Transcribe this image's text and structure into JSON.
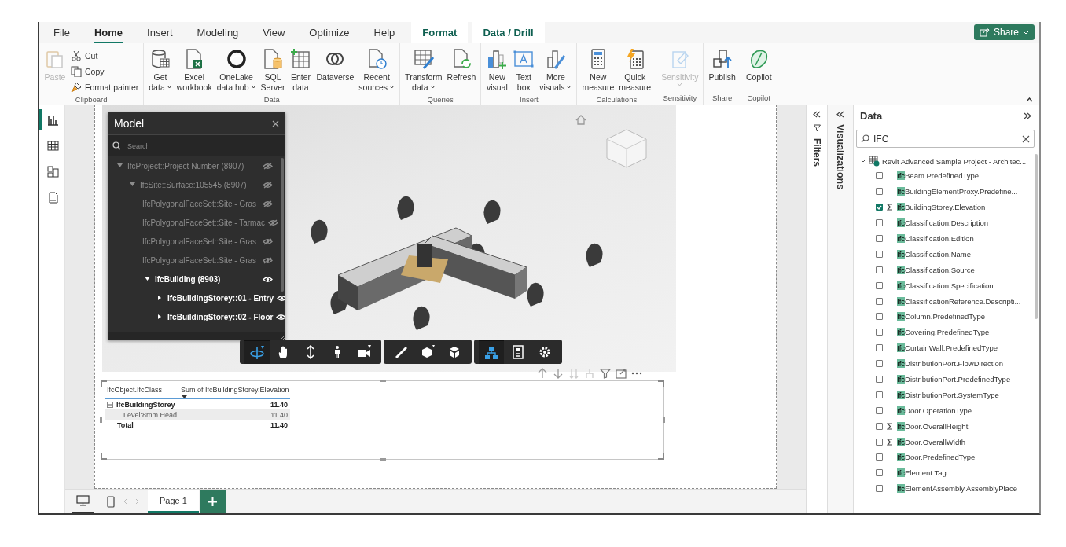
{
  "menu_tabs": [
    {
      "label": "File",
      "selected": false,
      "kind": "standard"
    },
    {
      "label": "Home",
      "selected": true,
      "kind": "standard"
    },
    {
      "label": "Insert",
      "selected": false,
      "kind": "standard"
    },
    {
      "label": "Modeling",
      "selected": false,
      "kind": "standard"
    },
    {
      "label": "View",
      "selected": false,
      "kind": "standard"
    },
    {
      "label": "Optimize",
      "selected": false,
      "kind": "standard"
    },
    {
      "label": "Help",
      "selected": false,
      "kind": "standard"
    },
    {
      "label": "Format",
      "selected": false,
      "kind": "contextual"
    },
    {
      "label": "Data / Drill",
      "selected": false,
      "kind": "contextual"
    }
  ],
  "share_button": {
    "label": "Share"
  },
  "ribbon_groups": [
    {
      "label": "Clipboard",
      "items": [
        {
          "kind": "large",
          "lines": [
            "Paste"
          ],
          "dropdown": false,
          "disabled": true
        },
        {
          "kind": "small",
          "lines": [
            "Cut"
          ],
          "disabled": false
        },
        {
          "kind": "small",
          "lines": [
            "Copy"
          ],
          "disabled": false
        },
        {
          "kind": "small",
          "lines": [
            "Format painter"
          ],
          "disabled": false
        }
      ]
    },
    {
      "label": "Data",
      "items": [
        {
          "kind": "large",
          "lines": [
            "Get",
            "data"
          ],
          "dropdown": true,
          "disabled": false
        },
        {
          "kind": "large",
          "lines": [
            "Excel",
            "workbook"
          ],
          "dropdown": false,
          "disabled": false
        },
        {
          "kind": "large",
          "lines": [
            "OneLake",
            "data hub"
          ],
          "dropdown": true,
          "disabled": false
        },
        {
          "kind": "large",
          "lines": [
            "SQL",
            "Server"
          ],
          "dropdown": false,
          "disabled": false
        },
        {
          "kind": "large",
          "lines": [
            "Enter",
            "data"
          ],
          "dropdown": false,
          "disabled": false
        },
        {
          "kind": "large",
          "lines": [
            "Dataverse"
          ],
          "dropdown": false,
          "disabled": false
        },
        {
          "kind": "large",
          "lines": [
            "Recent",
            "sources"
          ],
          "dropdown": true,
          "disabled": false
        }
      ]
    },
    {
      "label": "Queries",
      "items": [
        {
          "kind": "large",
          "lines": [
            "Transform",
            "data"
          ],
          "dropdown": true,
          "disabled": false
        },
        {
          "kind": "large",
          "lines": [
            "Refresh"
          ],
          "dropdown": false,
          "disabled": false
        }
      ]
    },
    {
      "label": "Insert",
      "items": [
        {
          "kind": "large",
          "lines": [
            "New",
            "visual"
          ],
          "dropdown": false,
          "disabled": false
        },
        {
          "kind": "large",
          "lines": [
            "Text",
            "box"
          ],
          "dropdown": false,
          "disabled": false
        },
        {
          "kind": "large",
          "lines": [
            "More",
            "visuals"
          ],
          "dropdown": true,
          "disabled": false
        }
      ]
    },
    {
      "label": "Calculations",
      "items": [
        {
          "kind": "large",
          "lines": [
            "New",
            "measure"
          ],
          "dropdown": false,
          "disabled": false
        },
        {
          "kind": "large",
          "lines": [
            "Quick",
            "measure"
          ],
          "dropdown": false,
          "disabled": false
        }
      ]
    },
    {
      "label": "Sensitivity",
      "items": [
        {
          "kind": "large",
          "lines": [
            "Sensitivity"
          ],
          "dropdown": true,
          "disabled": true
        }
      ]
    },
    {
      "label": "Share",
      "items": [
        {
          "kind": "large",
          "lines": [
            "Publish"
          ],
          "dropdown": false,
          "disabled": false
        }
      ]
    },
    {
      "label": "Copilot",
      "items": [
        {
          "kind": "large",
          "lines": [
            "Copilot"
          ],
          "dropdown": false,
          "disabled": false
        }
      ]
    }
  ],
  "left_nav": [
    {
      "selected": true
    },
    {
      "selected": false
    },
    {
      "selected": false
    },
    {
      "selected": false
    }
  ],
  "model_panel": {
    "title": "Model",
    "search": {
      "placeholder": "Search"
    },
    "tree": [
      {
        "label": "IfcProject::Project Number (8907)",
        "visible": false,
        "expanded": true,
        "children": [
          {
            "label": "IfcSite::Surface:105545 (8907)",
            "visible": false,
            "expanded": true,
            "children": [
              {
                "label": "IfcPolygonalFaceSet::Site - Gras",
                "visible": false
              },
              {
                "label": "IfcPolygonalFaceSet::Site - Tarmac",
                "visible": false
              },
              {
                "label": "IfcPolygonalFaceSet::Site - Gras",
                "visible": false
              },
              {
                "label": "IfcPolygonalFaceSet::Site - Gras",
                "visible": false
              },
              {
                "label": "IfcBuilding (8903)",
                "visible": true,
                "expanded": true,
                "children": [
                  {
                    "label": "IfcBuildingStorey::01 - Entry",
                    "visible": true,
                    "expanded": false
                  },
                  {
                    "label": "IfcBuildingStorey::02 - Floor",
                    "visible": true,
                    "expanded": false
                  }
                ]
              }
            ]
          }
        ]
      }
    ]
  },
  "viewer_toolbar": [
    [
      {
        "selected": true
      },
      {
        "selected": false
      },
      {
        "selected": false
      },
      {
        "selected": false
      },
      {
        "selected": false
      }
    ],
    [
      {
        "selected": false
      },
      {
        "selected": false
      },
      {
        "selected": false
      }
    ],
    [
      {
        "selected": true
      },
      {
        "selected": false
      },
      {
        "selected": false
      }
    ]
  ],
  "table": {
    "columns": [
      {
        "label": "IfcObject.IfcClass",
        "sorted": false
      },
      {
        "label": "Sum of IfcBuildingStorey.Elevation",
        "sorted": true
      }
    ],
    "rows": [
      {
        "kind": "group",
        "expanded": true,
        "cells": [
          "IfcBuildingStorey",
          "11.40"
        ]
      },
      {
        "kind": "detail",
        "cells": [
          "Level:8mm Head",
          "11.40"
        ]
      },
      {
        "kind": "total",
        "cells": [
          "Total",
          "11.40"
        ]
      }
    ]
  },
  "filters_pane": {
    "title": "Filters"
  },
  "visualizations_pane": {
    "title": "Visualizations"
  },
  "data_pane": {
    "title": "Data",
    "search": {
      "value": "IFC"
    },
    "model": {
      "label": "Revit Advanced Sample Project - Architec...",
      "expanded": true,
      "fields": [
        {
          "label": "IfcBeam.PredefinedType",
          "kind": "text",
          "checked": false
        },
        {
          "label": "IfcBuildingElementProxy.Predefine...",
          "kind": "text",
          "checked": false
        },
        {
          "label": "IfcBuildingStorey.Elevation",
          "kind": "numeric",
          "checked": true
        },
        {
          "label": "IfcClassification.Description",
          "kind": "text",
          "checked": false
        },
        {
          "label": "IfcClassification.Edition",
          "kind": "text",
          "checked": false
        },
        {
          "label": "IfcClassification.Name",
          "kind": "text",
          "checked": false
        },
        {
          "label": "IfcClassification.Source",
          "kind": "text",
          "checked": false
        },
        {
          "label": "IfcClassification.Specification",
          "kind": "text",
          "checked": false
        },
        {
          "label": "IfcClassificationReference.Descripti...",
          "kind": "text",
          "checked": false
        },
        {
          "label": "IfcColumn.PredefinedType",
          "kind": "text",
          "checked": false
        },
        {
          "label": "IfcCovering.PredefinedType",
          "kind": "text",
          "checked": false
        },
        {
          "label": "IfcCurtainWall.PredefinedType",
          "kind": "text",
          "checked": false
        },
        {
          "label": "IfcDistributionPort.FlowDirection",
          "kind": "text",
          "checked": false
        },
        {
          "label": "IfcDistributionPort.PredefinedType",
          "kind": "text",
          "checked": false
        },
        {
          "label": "IfcDistributionPort.SystemType",
          "kind": "text",
          "checked": false
        },
        {
          "label": "IfcDoor.OperationType",
          "kind": "text",
          "checked": false
        },
        {
          "label": "IfcDoor.OverallHeight",
          "kind": "numeric",
          "checked": false
        },
        {
          "label": "IfcDoor.OverallWidth",
          "kind": "numeric",
          "checked": false
        },
        {
          "label": "IfcDoor.PredefinedType",
          "kind": "text",
          "checked": false
        },
        {
          "label": "IfcElement.Tag",
          "kind": "text",
          "checked": false
        },
        {
          "label": "IfcElementAssembly.AssemblyPlace",
          "kind": "text",
          "checked": false
        }
      ]
    }
  },
  "pages": [
    {
      "label": "Page 1",
      "selected": true
    }
  ]
}
